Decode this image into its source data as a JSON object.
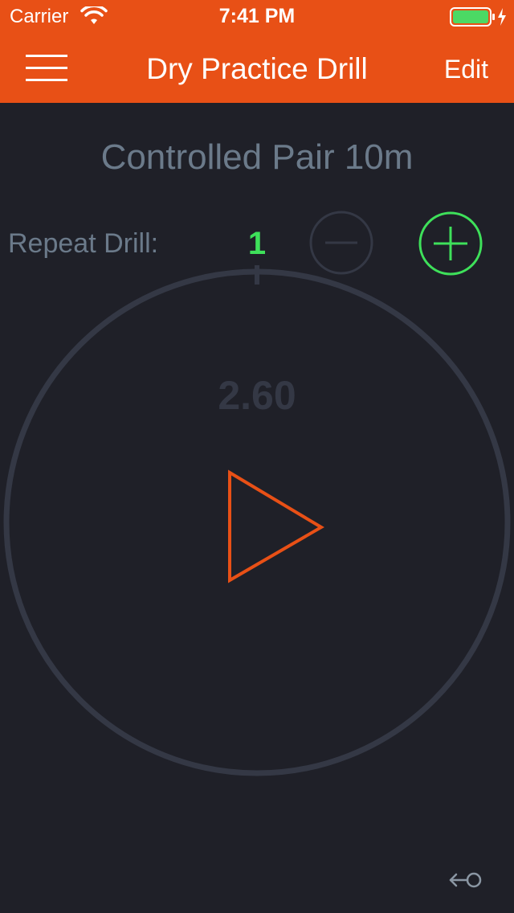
{
  "status_bar": {
    "carrier": "Carrier",
    "time": "7:41 PM",
    "wifi_icon": "wifi-icon",
    "battery_icon": "battery-charging-icon",
    "battery_color": "#4cd964"
  },
  "nav": {
    "title": "Dry Practice Drill",
    "edit_label": "Edit",
    "menu_icon": "hamburger-menu-icon"
  },
  "drill": {
    "name": "Controlled Pair 10m",
    "repeat_label": "Repeat Drill:",
    "repeat_count": "1",
    "timer_value": "2.60"
  },
  "controls": {
    "minus_icon": "minus-circle-icon",
    "plus_icon": "plus-circle-icon",
    "play_icon": "play-icon",
    "back_icon": "back-arrow-icon"
  },
  "colors": {
    "accent": "#e85016",
    "green": "#3ee05a",
    "muted_text": "#6b7a8a",
    "background": "#1f2028",
    "ring": "#343845"
  }
}
